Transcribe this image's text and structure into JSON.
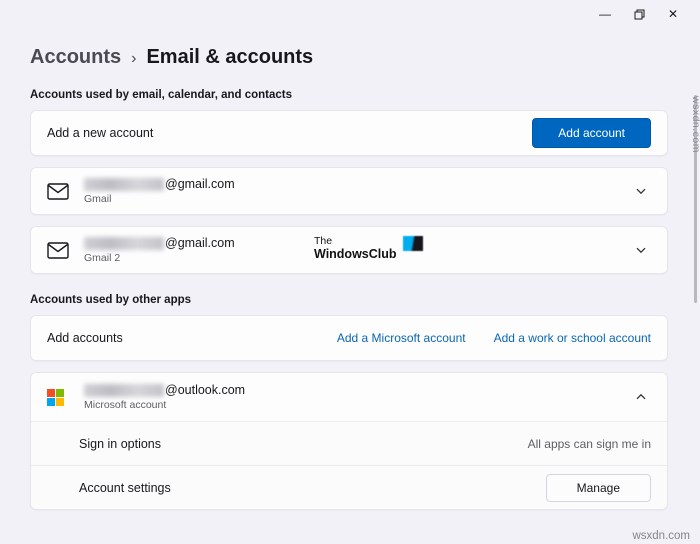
{
  "window": {
    "minimize": "—",
    "close": "✕"
  },
  "breadcrumb": {
    "root": "Accounts",
    "separator": "›",
    "current": "Email & accounts"
  },
  "section_mail": {
    "title": "Accounts used by email, calendar, and contacts",
    "add_card": {
      "label": "Add a new account",
      "button": "Add account"
    },
    "accounts": [
      {
        "domain": "@gmail.com",
        "provider": "Gmail"
      },
      {
        "domain": "@gmail.com",
        "provider": "Gmail 2"
      }
    ]
  },
  "section_apps": {
    "title": "Accounts used by other apps",
    "add_card": {
      "label": "Add accounts",
      "link_microsoft": "Add a Microsoft account",
      "link_work": "Add a work or school account"
    },
    "ms_account": {
      "domain": "@outlook.com",
      "provider": "Microsoft account",
      "signin_label": "Sign in options",
      "signin_value": "All apps can sign me in",
      "settings_label": "Account settings",
      "manage_button": "Manage"
    }
  },
  "watermarks": {
    "club_line1": "The",
    "club_line2": "WindowsClub",
    "side": "wsxdn.com",
    "bottom": "wsxdn.com"
  },
  "colors": {
    "accent": "#0067c0",
    "ms_red": "#f25022",
    "ms_green": "#7fba00",
    "ms_blue": "#00a4ef",
    "ms_yellow": "#ffb900"
  }
}
